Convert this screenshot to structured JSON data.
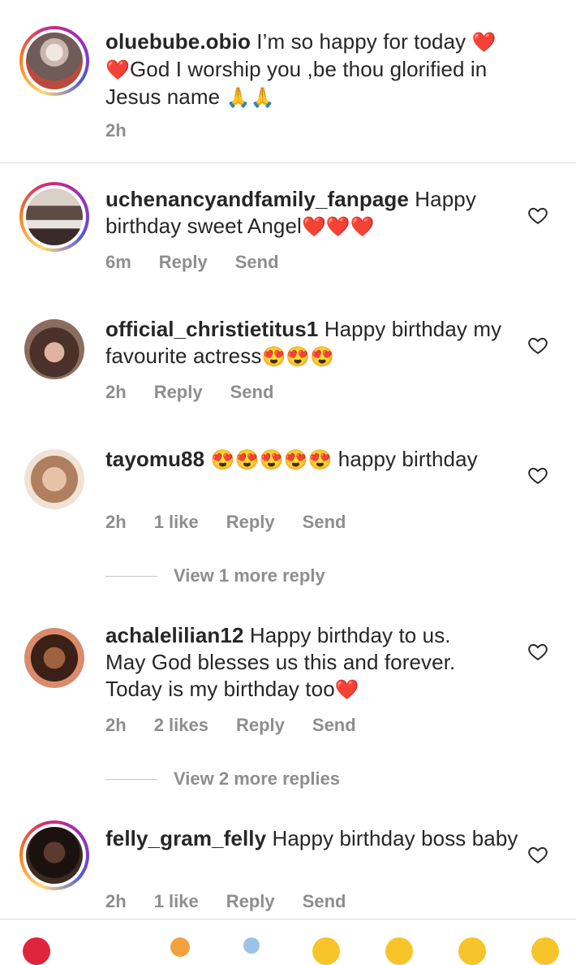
{
  "caption": {
    "username": "oluebube.obio",
    "text_parts": [
      "I’m so happy for today ",
      "❤️",
      "❤️",
      "God I worship you ,be thou glorified in Jesus name ",
      "🙏🙏"
    ],
    "time": "2h"
  },
  "comments": [
    {
      "username": "uchenancyandfamily_fanpage",
      "text": "Happy birthday sweet Angel",
      "emoji": "❤️❤️❤️",
      "time": "6m",
      "likes": "",
      "reply": "Reply",
      "send": "Send",
      "story_ring": true
    },
    {
      "username": "official_christietitus1",
      "text": "Happy birthday my favourite actress",
      "emoji": "😍😍😍",
      "time": "2h",
      "likes": "",
      "reply": "Reply",
      "send": "Send",
      "story_ring": false
    },
    {
      "username": "tayomu88",
      "text": "happy birthday",
      "emoji": "😍😍😍😍😍",
      "time": "2h",
      "likes": "1 like",
      "reply": "Reply",
      "send": "Send",
      "story_ring": false,
      "view_more": "View 1 more reply"
    },
    {
      "username": "achalelilian12",
      "text": "Happy birthday to us. May God blesses us this and forever. Today is my birthday too",
      "emoji": "❤️",
      "time": "2h",
      "likes": "2 likes",
      "reply": "Reply",
      "send": "Send",
      "story_ring": false,
      "view_more": "View 2 more replies"
    },
    {
      "username": "felly_gram_felly",
      "text": "Happy birthday boss baby",
      "emoji": "",
      "time": "2h",
      "likes": "1 like",
      "reply": "Reply",
      "send": "Send",
      "story_ring": true
    }
  ],
  "colors": {
    "meta_gray": "#8e8e8e",
    "divider": "#dbdbdb",
    "text": "#262626"
  },
  "icons": {
    "like": "heart-outline-icon"
  }
}
